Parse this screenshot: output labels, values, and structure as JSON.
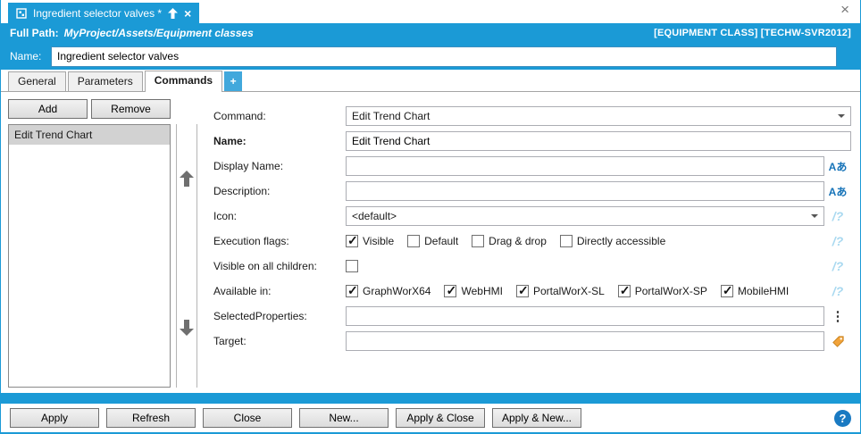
{
  "colors": {
    "accent_blue": "#1B9AD6",
    "plus_tab_blue": "#41A8DC",
    "selected_item_gray": "#D2D2D2",
    "help_blue": "#1A7AC2",
    "target_tag_orange": "#F2A33A",
    "quick_pick_blue": "#A9D9F0"
  },
  "window": {
    "tab_title": "Ingredient selector valves *",
    "tab_close_glyph": "×",
    "window_close_glyph": "×"
  },
  "header": {
    "full_path_label": "Full Path:",
    "full_path_value": "MyProject/Assets/Equipment classes",
    "context": "[EQUIPMENT CLASS] [TECHW-SVR2012]",
    "name_label": "Name:",
    "name_value": "Ingredient selector valves"
  },
  "tabs": [
    {
      "label": "General",
      "active": false
    },
    {
      "label": "Parameters",
      "active": false
    },
    {
      "label": "Commands",
      "active": true
    },
    {
      "label": "+",
      "active": false
    }
  ],
  "commands_panel": {
    "add_label": "Add",
    "remove_label": "Remove",
    "items": [
      {
        "label": "Edit Trend Chart",
        "selected": true
      }
    ]
  },
  "form": {
    "command": {
      "label": "Command:",
      "value": "Edit Trend Chart"
    },
    "name": {
      "label": "Name:",
      "value": "Edit Trend Chart"
    },
    "display_name": {
      "label": "Display Name:",
      "value": ""
    },
    "description": {
      "label": "Description:",
      "value": ""
    },
    "icon": {
      "label": "Icon:",
      "value": "<default>"
    },
    "execution_flags": {
      "label": "Execution flags:",
      "options": [
        {
          "label": "Visible",
          "checked": true
        },
        {
          "label": "Default",
          "checked": false
        },
        {
          "label": "Drag & drop",
          "checked": false
        },
        {
          "label": "Directly accessible",
          "checked": false
        }
      ]
    },
    "visible_on_all_children": {
      "label": "Visible on all children:",
      "checked": false
    },
    "available_in": {
      "label": "Available in:",
      "options": [
        {
          "label": "GraphWorX64",
          "checked": true
        },
        {
          "label": "WebHMI",
          "checked": true
        },
        {
          "label": "PortalWorX-SL",
          "checked": true
        },
        {
          "label": "PortalWorX-SP",
          "checked": true
        },
        {
          "label": "MobileHMI",
          "checked": true
        }
      ]
    },
    "selected_properties": {
      "label": "SelectedProperties:",
      "value": ""
    },
    "target": {
      "label": "Target:",
      "value": ""
    }
  },
  "icons": {
    "localization_glyph": "Aあ",
    "more_glyph": "⋮",
    "quick_pick_glyph": "/?"
  },
  "footer": {
    "buttons": [
      "Apply",
      "Refresh",
      "Close",
      "New...",
      "Apply & Close",
      "Apply & New..."
    ],
    "help": "?"
  }
}
